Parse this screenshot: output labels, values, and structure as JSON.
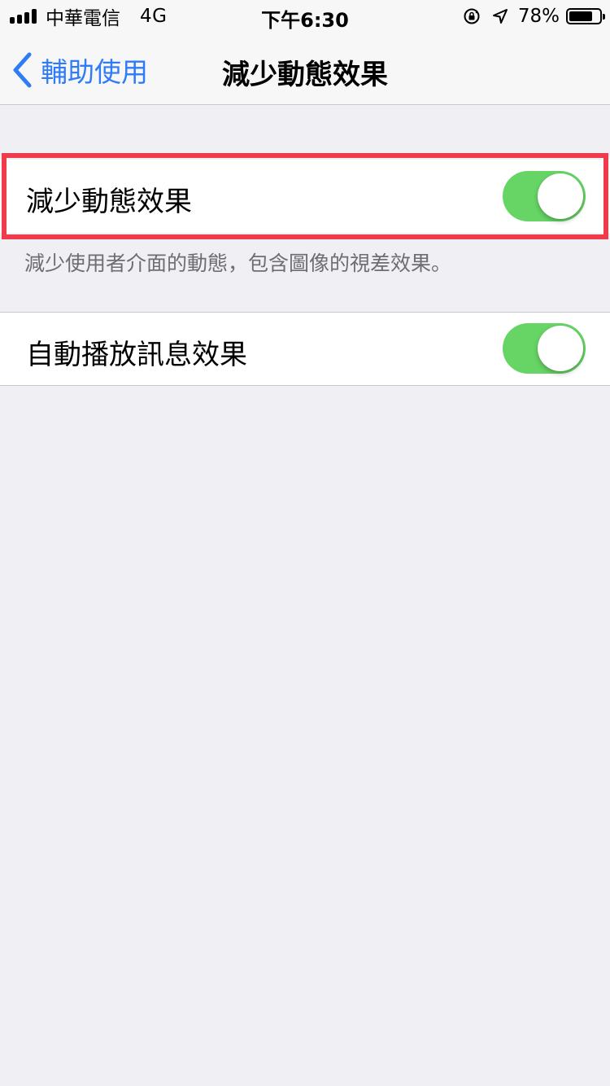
{
  "status_bar": {
    "carrier": "中華電信",
    "network": "4G",
    "time": "下午6:30",
    "battery_percent": "78%",
    "battery_level": 0.78,
    "icons": [
      "signal-icon",
      "rotation-lock-icon",
      "location-arrow-icon",
      "battery-icon"
    ]
  },
  "nav": {
    "back_label": "輔助使用",
    "title": "減少動態效果"
  },
  "settings": [
    {
      "label": "減少動態效果",
      "enabled": true,
      "footer": "減少使用者介面的動態，包含圖像的視差效果。"
    },
    {
      "label": "自動播放訊息效果",
      "enabled": true
    }
  ],
  "colors": {
    "accent": "#2f7cf6",
    "toggle_on": "#66d565",
    "highlight": "#ef3b4a",
    "background": "#efeff4"
  }
}
